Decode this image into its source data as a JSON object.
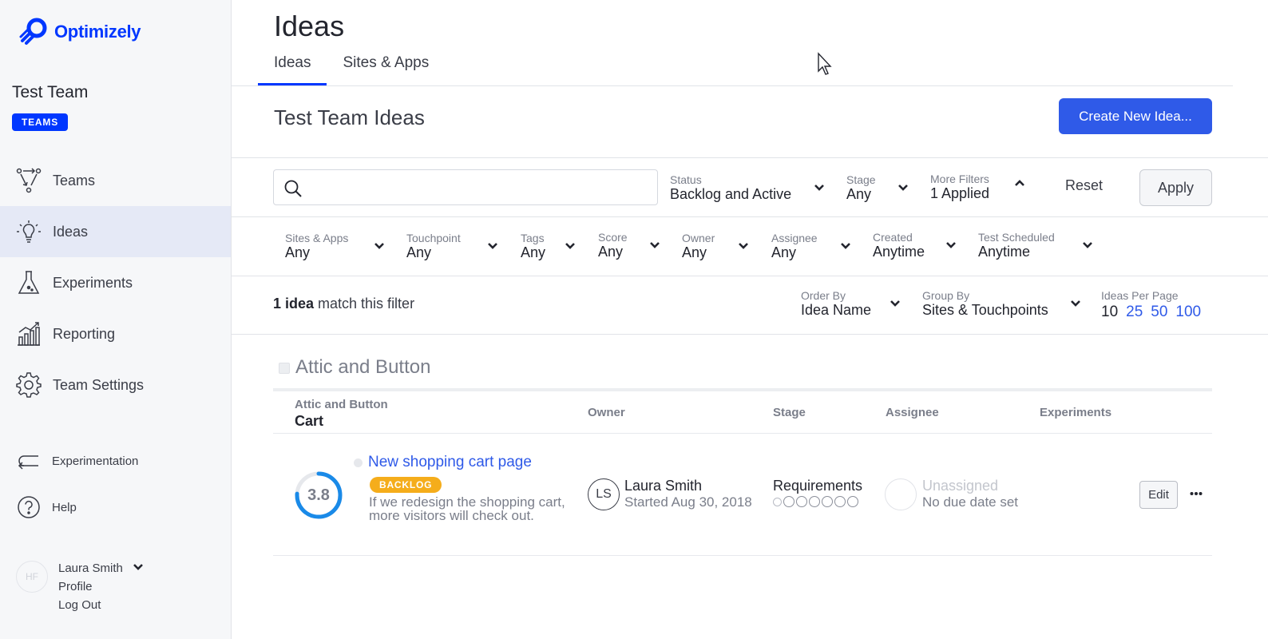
{
  "brand": {
    "name": "Optimizely",
    "color": "#0037ff"
  },
  "sidebar": {
    "team_name": "Test Team",
    "team_badge": "TEAMS",
    "nav": [
      {
        "label": "Teams",
        "icon": "teams-icon"
      },
      {
        "label": "Ideas",
        "icon": "lightbulb-icon",
        "active": true
      },
      {
        "label": "Experiments",
        "icon": "flask-icon"
      },
      {
        "label": "Reporting",
        "icon": "chart-icon"
      },
      {
        "label": "Team Settings",
        "icon": "gear-icon"
      }
    ],
    "secondary": [
      {
        "label": "Experimentation",
        "icon": "return-arrow-icon"
      },
      {
        "label": "Help",
        "icon": "help-icon"
      }
    ],
    "user": {
      "initials": "HF",
      "name": "Laura Smith",
      "profile": "Profile",
      "logout": "Log Out"
    }
  },
  "header": {
    "title": "Ideas",
    "tabs": [
      {
        "label": "Ideas",
        "active": true
      },
      {
        "label": "Sites & Apps",
        "active": false
      }
    ]
  },
  "section": {
    "title": "Test Team Ideas",
    "create_button": "Create New Idea..."
  },
  "filters": {
    "search_placeholder": "",
    "status": {
      "label": "Status",
      "value": "Backlog and Active"
    },
    "stage": {
      "label": "Stage",
      "value": "Any"
    },
    "more": {
      "label": "More Filters",
      "value": "1 Applied"
    },
    "reset": "Reset",
    "apply": "Apply",
    "extra": [
      {
        "label": "Sites & Apps",
        "value": "Any"
      },
      {
        "label": "Touchpoint",
        "value": "Any"
      },
      {
        "label": "Tags",
        "value": "Any"
      },
      {
        "label": "Score",
        "value": "Any"
      },
      {
        "label": "Owner",
        "value": "Any"
      },
      {
        "label": "Assignee",
        "value": "Any"
      },
      {
        "label": "Created",
        "value": "Anytime"
      },
      {
        "label": "Test Scheduled",
        "value": "Anytime"
      }
    ]
  },
  "results": {
    "count": "1 idea",
    "count_suffix": " match this filter",
    "order_by": {
      "label": "Order By",
      "value": "Idea Name"
    },
    "group_by": {
      "label": "Group By",
      "value": "Sites & Touchpoints"
    },
    "per_page": {
      "label": "Ideas Per Page",
      "options": [
        "10",
        "25",
        "50",
        "100"
      ],
      "current": "10"
    }
  },
  "group": {
    "title": "Attic and Button",
    "columns": {
      "site": "Attic and Button",
      "touchpoint": "Cart",
      "owner": "Owner",
      "stage": "Stage",
      "assignee": "Assignee",
      "experiments": "Experiments"
    },
    "ideas": [
      {
        "score": "3.8",
        "score_fraction": 0.76,
        "title": "New shopping cart page",
        "status": "BACKLOG",
        "description": "If we redesign the shopping cart, more visitors will check out.",
        "owner_initials": "LS",
        "owner_name": "Laura Smith",
        "owner_started": "Started Aug 30, 2018",
        "stage": "Requirements",
        "assignee": "Unassigned",
        "due": "No due date set",
        "edit": "Edit",
        "status_color": "#f5ad1b",
        "score_color": "#1a8ae8"
      }
    ]
  }
}
